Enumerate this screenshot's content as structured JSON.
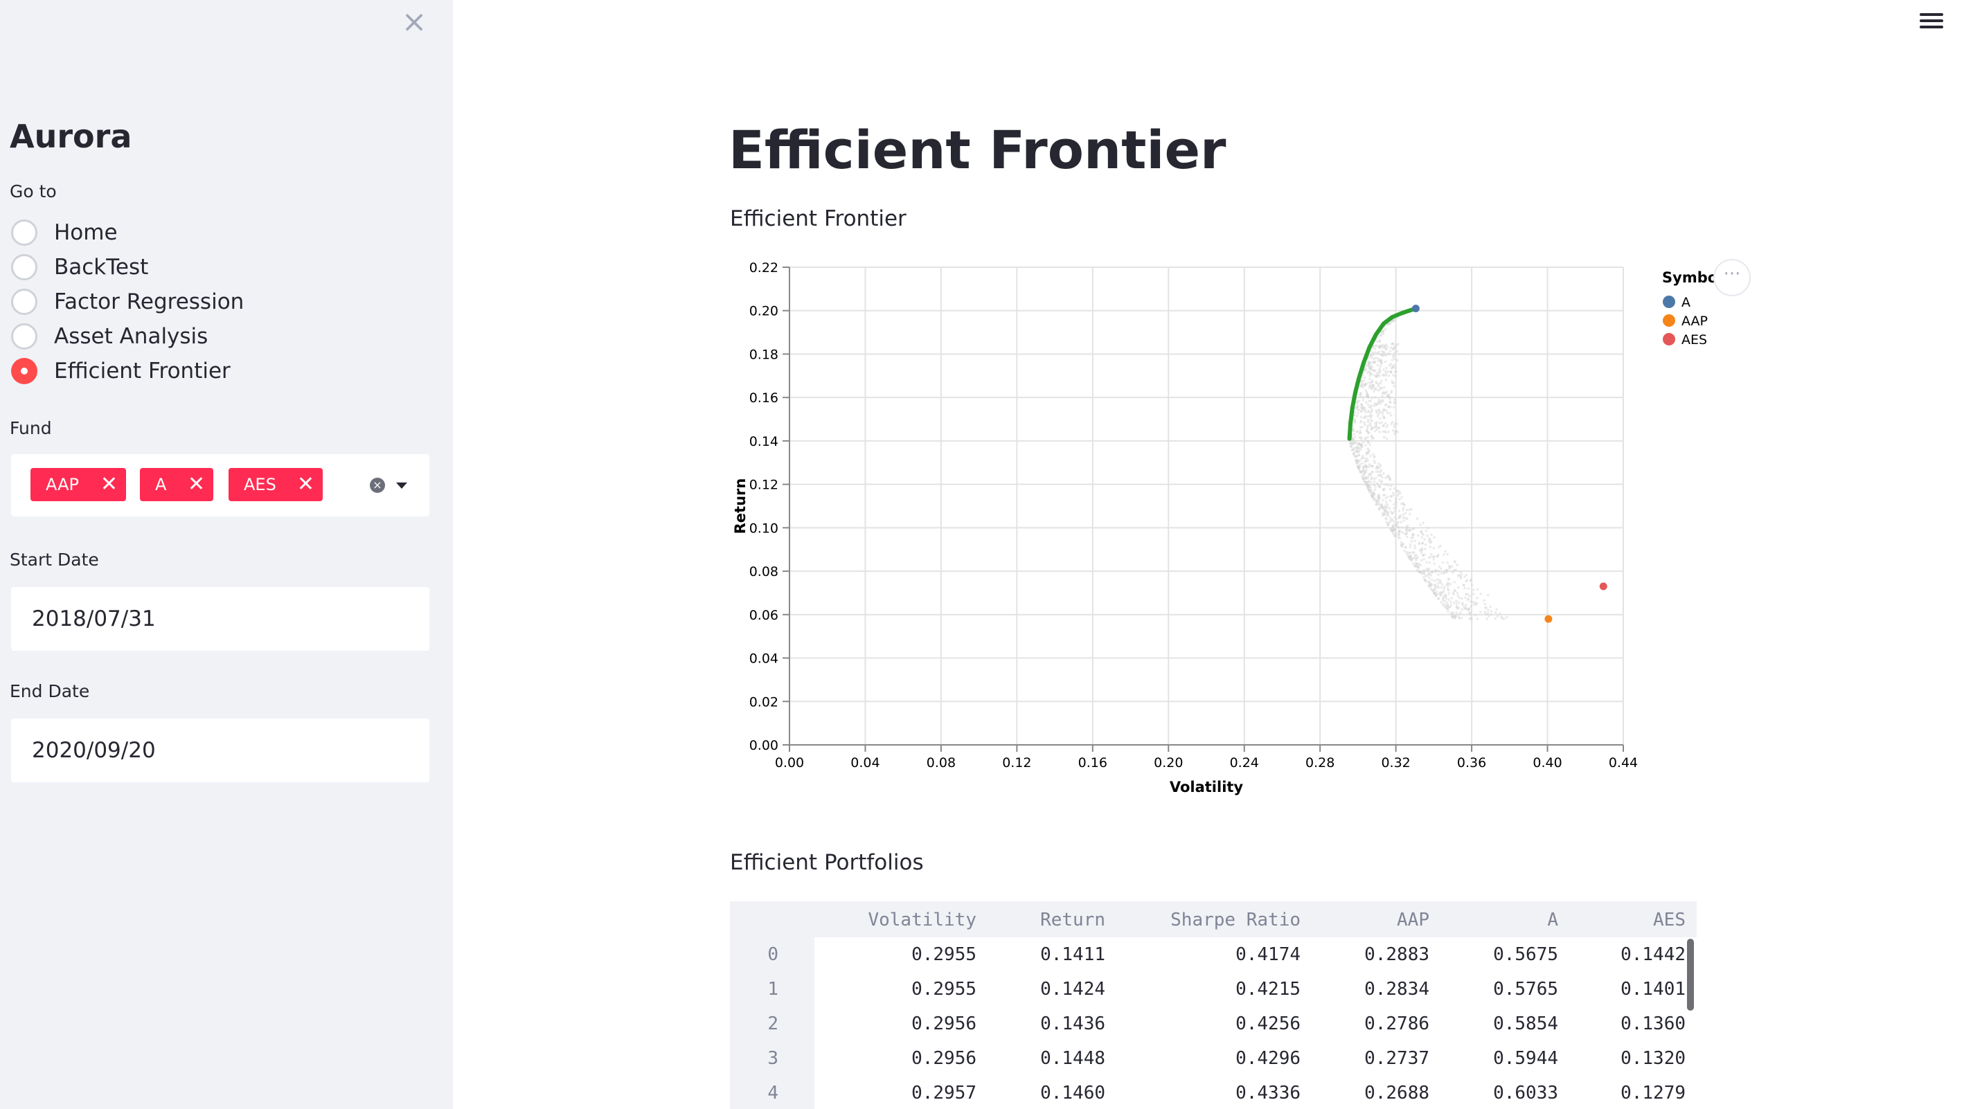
{
  "sidebar": {
    "app_title": "Aurora",
    "goto_label": "Go to",
    "pages": [
      {
        "label": "Home",
        "selected": false
      },
      {
        "label": "BackTest",
        "selected": false
      },
      {
        "label": "Factor Regression",
        "selected": false
      },
      {
        "label": "Asset Analysis",
        "selected": false
      },
      {
        "label": "Efficient Frontier",
        "selected": true
      }
    ],
    "fund_label": "Fund",
    "funds": [
      "AAP",
      "A",
      "AES"
    ],
    "start_date_label": "Start Date",
    "start_date": "2018/07/31",
    "end_date_label": "End Date",
    "end_date": "2020/09/20",
    "close_icon": "close-icon",
    "chip_remove_glyph": "✕",
    "accent_color": "#ff2b52"
  },
  "main": {
    "title": "Efficient Frontier",
    "chart_subheader": "Efficient Frontier",
    "table_subheader": "Efficient Portfolios",
    "more_actions": "···"
  },
  "chart_data": {
    "type": "scatter",
    "xlabel": "Volatility",
    "ylabel": "Return",
    "xlim": [
      0,
      0.44
    ],
    "ylim": [
      0,
      0.22
    ],
    "x_ticks": [
      "0.00",
      "0.04",
      "0.08",
      "0.12",
      "0.16",
      "0.20",
      "0.24",
      "0.28",
      "0.32",
      "0.36",
      "0.40",
      "0.44"
    ],
    "y_ticks": [
      "0.00",
      "0.02",
      "0.04",
      "0.06",
      "0.08",
      "0.10",
      "0.12",
      "0.14",
      "0.16",
      "0.18",
      "0.20",
      "0.22"
    ],
    "grid": true,
    "legend": {
      "title": "Symbol",
      "placement": "right",
      "entries": [
        {
          "name": "A",
          "color": "#4c78a8"
        },
        {
          "name": "AAP",
          "color": "#f58518"
        },
        {
          "name": "AES",
          "color": "#e45756"
        }
      ]
    },
    "assets": [
      {
        "symbol": "A",
        "x": 0.3305,
        "y": 0.201,
        "color": "#4c78a8"
      },
      {
        "symbol": "AAP",
        "x": 0.4005,
        "y": 0.058,
        "color": "#f58518"
      },
      {
        "symbol": "AES",
        "x": 0.4295,
        "y": 0.073,
        "color": "#e45756"
      }
    ],
    "frontier": {
      "color": "#2ca02c",
      "points": [
        [
          0.2955,
          0.141
        ],
        [
          0.296,
          0.148
        ],
        [
          0.297,
          0.155
        ],
        [
          0.2985,
          0.162
        ],
        [
          0.3005,
          0.169
        ],
        [
          0.303,
          0.176
        ],
        [
          0.306,
          0.183
        ],
        [
          0.3095,
          0.189
        ],
        [
          0.3135,
          0.194
        ],
        [
          0.318,
          0.197
        ],
        [
          0.3235,
          0.199
        ],
        [
          0.3305,
          0.201
        ]
      ]
    },
    "random_portfolios_color": "#d3d3d3"
  },
  "table": {
    "columns": [
      "",
      "Volatility",
      "Return",
      "Sharpe Ratio",
      "AAP",
      "A",
      "AES"
    ],
    "rows": [
      [
        "0",
        "0.2955",
        "0.1411",
        "0.4174",
        "0.2883",
        "0.5675",
        "0.1442"
      ],
      [
        "1",
        "0.2955",
        "0.1424",
        "0.4215",
        "0.2834",
        "0.5765",
        "0.1401"
      ],
      [
        "2",
        "0.2956",
        "0.1436",
        "0.4256",
        "0.2786",
        "0.5854",
        "0.1360"
      ],
      [
        "3",
        "0.2956",
        "0.1448",
        "0.4296",
        "0.2737",
        "0.5944",
        "0.1320"
      ],
      [
        "4",
        "0.2957",
        "0.1460",
        "0.4336",
        "0.2688",
        "0.6033",
        "0.1279"
      ]
    ]
  }
}
